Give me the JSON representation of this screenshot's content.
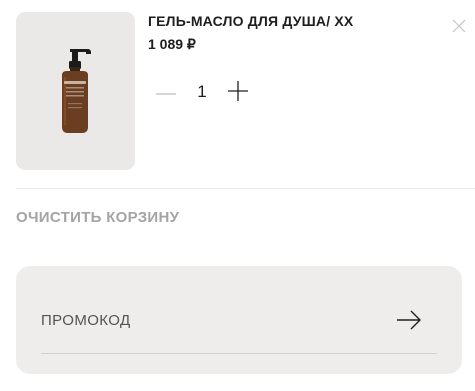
{
  "cart": {
    "items": [
      {
        "name": "ГЕЛЬ-МАСЛО ДЛЯ ДУША/ XX",
        "price": "1 089 ₽",
        "quantity": "1",
        "image_icon": "shower-gel-bottle-icon",
        "bottle_label": "la ruche"
      }
    ],
    "clear_label": "ОЧИСТИТЬ КОРЗИНУ"
  },
  "promo": {
    "placeholder": "ПРОМОКОД",
    "submit_icon": "arrow-right-icon"
  },
  "colors": {
    "panel_bg": "#efedeb",
    "image_bg": "#ebe9e7",
    "muted_text": "#a4a4a4",
    "bottle": "#6b3e22"
  }
}
